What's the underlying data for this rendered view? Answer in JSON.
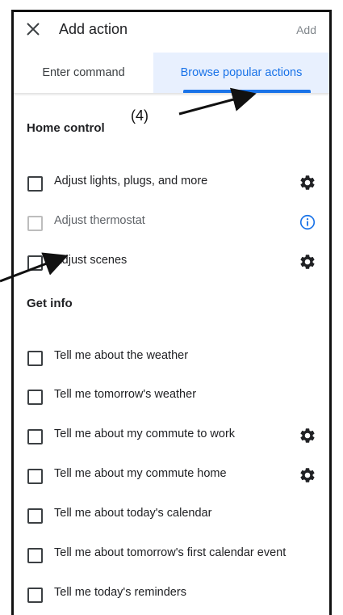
{
  "header": {
    "title": "Add action",
    "add_label": "Add"
  },
  "tabs": [
    {
      "label": "Enter command",
      "active": false
    },
    {
      "label": "Browse popular actions",
      "active": true
    }
  ],
  "annotation": {
    "label": "(4)"
  },
  "sections": [
    {
      "title": "Home control",
      "items": [
        {
          "label": "Adjust lights, plugs, and more",
          "icon": "gear-icon",
          "checked": false,
          "disabled": false
        },
        {
          "label": "Adjust thermostat",
          "icon": "info-icon",
          "checked": false,
          "disabled": true
        },
        {
          "label": "Adjust scenes",
          "icon": "gear-icon",
          "checked": false,
          "disabled": false
        }
      ]
    },
    {
      "title": "Get info",
      "items": [
        {
          "label": "Tell me about the weather",
          "icon": "",
          "checked": false,
          "disabled": false
        },
        {
          "label": "Tell me tomorrow's weather",
          "icon": "",
          "checked": false,
          "disabled": false
        },
        {
          "label": "Tell me about my commute to work",
          "icon": "gear-icon",
          "checked": false,
          "disabled": false
        },
        {
          "label": "Tell me about my commute home",
          "icon": "gear-icon",
          "checked": false,
          "disabled": false
        },
        {
          "label": "Tell me about today's calendar",
          "icon": "",
          "checked": false,
          "disabled": false
        },
        {
          "label": "Tell me about tomorrow's first calendar event",
          "icon": "",
          "checked": false,
          "disabled": false
        },
        {
          "label": "Tell me today's reminders",
          "icon": "",
          "checked": false,
          "disabled": false
        }
      ]
    }
  ],
  "colors": {
    "accent": "#1a73e8",
    "tab_active_bg": "#e8f0fe",
    "text": "#202124",
    "muted": "#80868b"
  }
}
